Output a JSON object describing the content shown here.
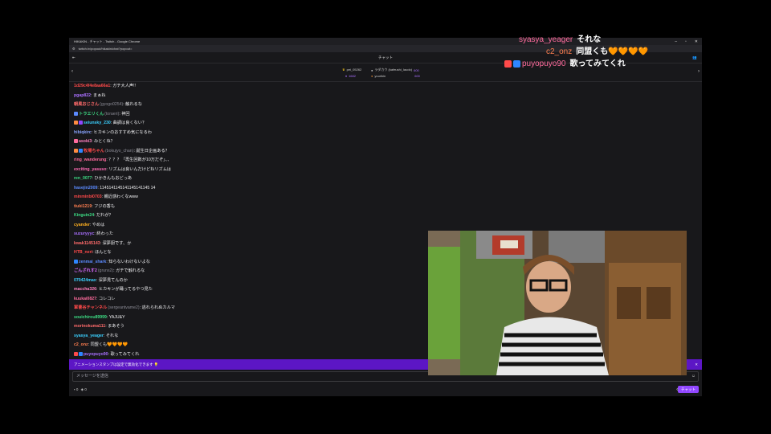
{
  "browser": {
    "title": "HIKAKIN - チャット - Twitch - Google Chrome",
    "url": "twitch.tv/popout/hikakin/chat?popout="
  },
  "chat": {
    "header": "チャット",
    "pinned": [
      {
        "name": "pei_05262",
        "count": "1682"
      },
      {
        "name": "ラダカウ (kafeushi_laudo)",
        "count": "600"
      },
      {
        "name": "yuurikin",
        "count": "600"
      }
    ],
    "messages": [
      {
        "user": "1d29c4f4e8aa66a1",
        "color": "#ff4a4a",
        "text": ": ガチ大人声!!"
      },
      {
        "user": "pgap822",
        "color": "#a970ff",
        "text": ": まぁね"
      },
      {
        "user": "朝風おじさん",
        "handle": "(gyogo0254)",
        "color": "#ff6b6b",
        "text": ": 触れるな"
      },
      {
        "user": "トラエリくん",
        "handle": "(toraeri)",
        "color": "#3ddc84",
        "text": ": 神回",
        "badges": [
          "#5c8bff"
        ]
      },
      {
        "user": "seiunsky_230",
        "color": "#3bd0ff",
        "text": ": 曲調は良くない？",
        "badges": [
          "#ff8c42",
          "#9147ff"
        ]
      },
      {
        "user": "hibiqkirc",
        "color": "#8aa4ff",
        "text": ": ヒカキンのおすすめ気になるわ"
      },
      {
        "user": "asoki3",
        "color": "#ff80bf",
        "text": ": みとくね？",
        "badges": [
          "#ff6b9d"
        ]
      },
      {
        "user": "牧場ちゃん",
        "handle": "(bokujyo_chan)",
        "color": "#ff4a4a",
        "text": ": 誕生日企画ある？",
        "badges": [
          "#ff8c42",
          "#2e86ff"
        ]
      },
      {
        "user": "ring_wanderung",
        "color": "#ff6b9d",
        "text": ": ？？？「再生回数が10万だぞ」、、"
      },
      {
        "user": "exciting_yasuso",
        "color": "#ff6bb5",
        "text": ": リズムは良いんだけどねリズムは"
      },
      {
        "user": "ren_0077",
        "color": "#3ddc84",
        "text": ": ひかきんもおどっあ"
      },
      {
        "user": "hasejin2009",
        "color": "#5c8bff",
        "text": ": 1145141145141145141145 14"
      },
      {
        "user": "minminbi0703",
        "color": "#ff4a4a",
        "text": ": 親近感わくなwww"
      },
      {
        "user": "tiuki1219",
        "color": "#ff7f50",
        "text": ": フジの香も"
      },
      {
        "user": "Kinguin24",
        "color": "#3ddc84",
        "text": ": だれが？"
      },
      {
        "user": "cyander",
        "color": "#ffb020",
        "text": ": やめは"
      },
      {
        "user": "suzuryyyc",
        "color": "#a970ff",
        "text": ": 終わった"
      },
      {
        "user": "kwak1145143",
        "color": "#ff6b6b",
        "text": ": 深夢厨です、か"
      },
      {
        "user": "HTB_neri",
        "color": "#ff4a4a",
        "text": ": ほんとな"
      },
      {
        "user": "zenmai_shark",
        "color": "#5c8bff",
        "text": ": 知らないわけないよな",
        "badges": [
          "#2e86ff"
        ]
      },
      {
        "user": "ごんざれす2",
        "handle": "(gruns2)",
        "color": "#d86bff",
        "text": ": ガチで触れるな"
      },
      {
        "user": "070424max",
        "color": "#3bd0ff",
        "text": ": 深夢見てんのか"
      },
      {
        "user": "maccha326",
        "color": "#ff80bf",
        "text": ": ヒカキンが踊ってるやつ見た"
      },
      {
        "user": "kuukai0827",
        "color": "#ff6b9d",
        "text": ": コレコレ"
      },
      {
        "user": "軍曹谷チャンネル",
        "handle": "(sergeantvame2)",
        "color": "#ff4a4a",
        "text": ": 逃れられぬカルマ"
      },
      {
        "user": "souichirou89999",
        "color": "#3ddc84",
        "text": ": YAJU&Y"
      },
      {
        "user": "morinokuma111",
        "color": "#ff6b6b",
        "text": ": まあそう"
      },
      {
        "user": "syasya_yeager",
        "color": "#3bd0ff",
        "text": ": それな"
      },
      {
        "user": "c2_onz",
        "color": "#ff7f50",
        "text": ": 同盟くも🧡🧡🧡🧡"
      },
      {
        "user": "puyopuyo90",
        "color": "#a970ff",
        "text": ": 歌ってみてくれ",
        "badges": [
          "#ff4a4a",
          "#2e86ff"
        ]
      }
    ],
    "announcement": "アニメーションスタンプは設定で無効化できます",
    "input_placeholder": "メッセージを送信",
    "points": "0",
    "bits": "0",
    "chat_button": "チャット"
  },
  "overlay": [
    {
      "user": "syasya_yeager",
      "color": "#ff6b9d",
      "text": "それな"
    },
    {
      "user": "c2_onz",
      "color": "#ff7f50",
      "text": "同盟くも🧡🧡🧡🧡"
    },
    {
      "user": "puyopuyo90",
      "color": "#ff6b9d",
      "text": "歌ってみてくれ"
    }
  ]
}
